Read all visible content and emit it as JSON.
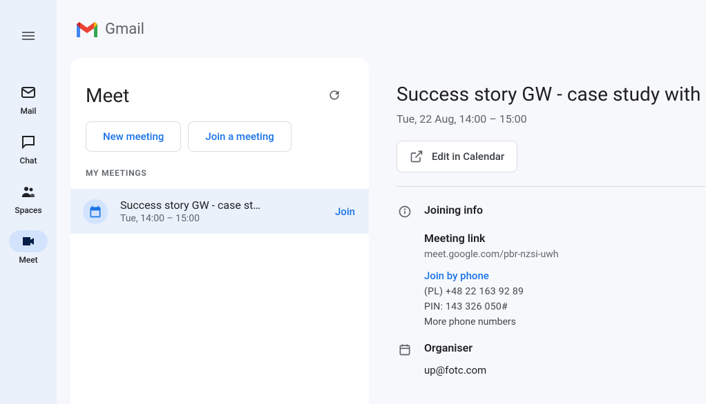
{
  "app": {
    "name": "Gmail"
  },
  "sidebar": {
    "items": [
      {
        "label": "Mail"
      },
      {
        "label": "Chat"
      },
      {
        "label": "Spaces"
      },
      {
        "label": "Meet"
      }
    ]
  },
  "meet": {
    "title": "Meet",
    "newMeeting": "New meeting",
    "joinMeeting": "Join a meeting",
    "myMeetings": "MY MEETINGS",
    "meetings": [
      {
        "title": "Success story GW - case st…",
        "time": "Tue, 14:00 – 15:00",
        "join": "Join"
      }
    ]
  },
  "event": {
    "title": "Success story GW - case study with",
    "datetime": "Tue, 22 Aug, 14:00 – 15:00",
    "editLabel": "Edit in Calendar",
    "joiningInfo": "Joining info",
    "meetingLinkLabel": "Meeting link",
    "meetingLink": "meet.google.com/pbr-nzsi-uwh",
    "joinByPhone": "Join by phone",
    "phone": "(PL) +48 22 163 92 89",
    "pin": "PIN: 143 326 050#",
    "morePhone": "More phone numbers",
    "organiserLabel": "Organiser",
    "organiserEmail": "up@fotc.com"
  }
}
